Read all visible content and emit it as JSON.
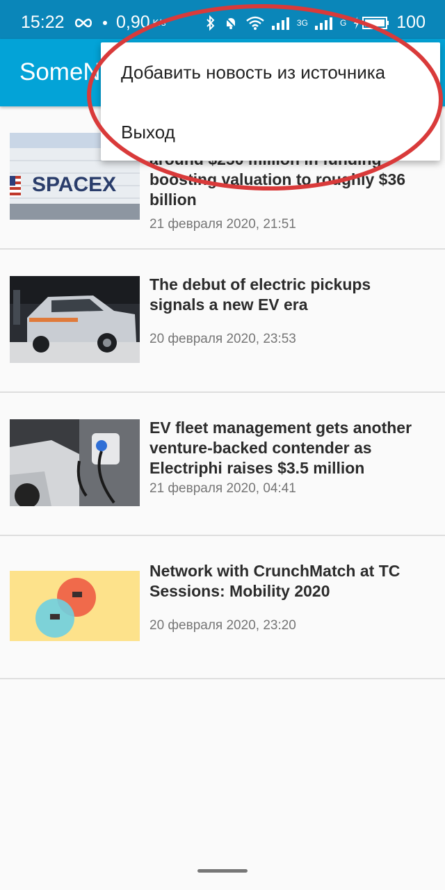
{
  "status_bar": {
    "time": "15:22",
    "speed": "0,90",
    "speed_unit": "K/s",
    "net_3g": "3G",
    "net_g": "G",
    "battery": "100"
  },
  "app_bar": {
    "title": "SomeNews"
  },
  "menu": {
    "items": [
      {
        "label": "Добавить новость из источника"
      },
      {
        "label": "Выход"
      }
    ]
  },
  "news": [
    {
      "headline": "around $250 million in funding boosting valuation to roughly $36 billion",
      "date": "21 февраля 2020, 21:51",
      "image": "spacex-building",
      "image_text": "SPACEX"
    },
    {
      "headline": "The debut of electric pickups signals a new EV era",
      "date": "20 февраля 2020, 23:53",
      "image": "electric-pickup"
    },
    {
      "headline": "EV fleet management gets another venture-backed contender as Electriphi raises $3.5 million",
      "date": "21 февраля 2020, 04:41",
      "image": "ev-charger"
    },
    {
      "headline": "Network with CrunchMatch at TC Sessions: Mobility 2020",
      "date": "20 февраля 2020, 23:20",
      "image": "crunchmatch-illustration"
    }
  ],
  "colors": {
    "status_bar": "#0a86b9",
    "app_bar": "#03a3d7",
    "annotation": "#d93a3a"
  }
}
